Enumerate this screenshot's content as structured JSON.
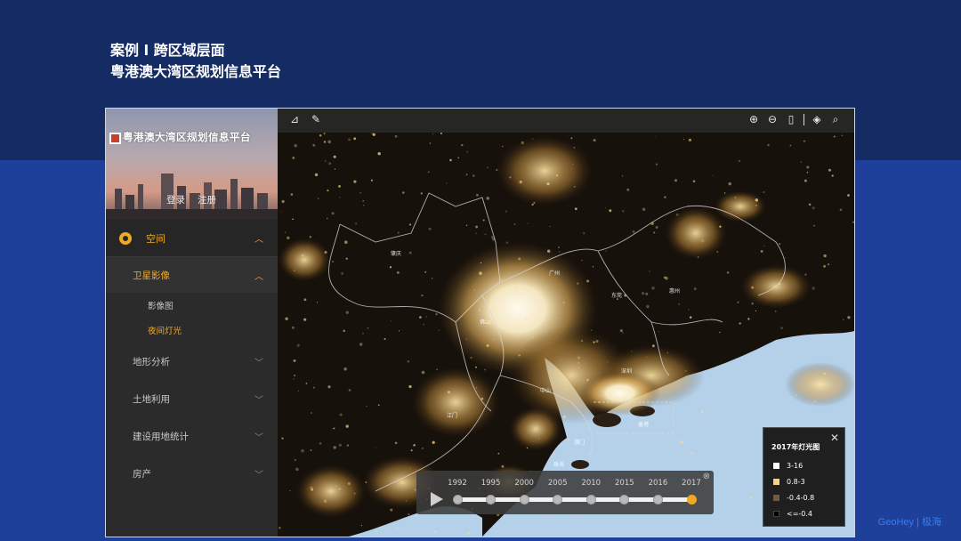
{
  "slide": {
    "title_line1": "案例 l 跨区域层面",
    "title_line2": "粤港澳大湾区规划信息平台",
    "brand": "GeoHey | 极海"
  },
  "app": {
    "name": "粤港澳大湾区规划信息平台",
    "login": "登录",
    "register": "注册"
  },
  "sidebar": {
    "section": "空间",
    "group_open": "卫星影像",
    "sub_items": [
      "影像图",
      "夜间灯光"
    ],
    "active_sub": "夜间灯光",
    "groups": [
      "地形分析",
      "土地利用",
      "建设用地统计",
      "房产"
    ]
  },
  "map": {
    "labels": [
      "肇庆",
      "广州",
      "佛山",
      "东莞",
      "惠州",
      "深圳",
      "江门",
      "中山",
      "珠海",
      "香港",
      "澳门"
    ]
  },
  "legend": {
    "title": "2017年灯光图",
    "entries": [
      {
        "label": "3-16",
        "color": "#ffffff"
      },
      {
        "label": "0.8-3",
        "color": "#f5d08a"
      },
      {
        "label": "-0.4-0.8",
        "color": "#6e5a45"
      },
      {
        "label": "<=-0.4",
        "color": "#000000"
      }
    ]
  },
  "timeline": {
    "years": [
      "1992",
      "1995",
      "2000",
      "2005",
      "2010",
      "2015",
      "2016",
      "2017"
    ],
    "selected": "2017"
  },
  "colors": {
    "accent": "#f0a923",
    "slide_bg_top": "#142b63",
    "slide_bg_bottom": "#1e3f9a",
    "sea": "#b5d1ea"
  }
}
